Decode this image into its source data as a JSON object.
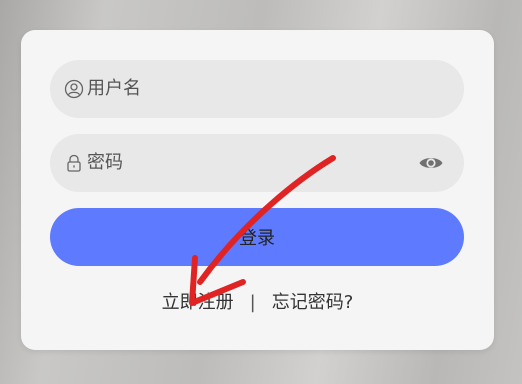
{
  "login_form": {
    "username": {
      "placeholder": "用户名",
      "value": "",
      "icon": "user-icon"
    },
    "password": {
      "placeholder": "密码",
      "value": "",
      "icon": "lock-icon",
      "toggle_icon": "eye-icon"
    },
    "login_label": "登录",
    "register_label": "立即注册",
    "separator": "|",
    "forgot_label": "忘记密码?"
  },
  "colors": {
    "card_background": "#f5f5f5",
    "field_background": "#e8e8e8",
    "accent": "#5e7bff",
    "annotation_arrow": "#e02424"
  }
}
